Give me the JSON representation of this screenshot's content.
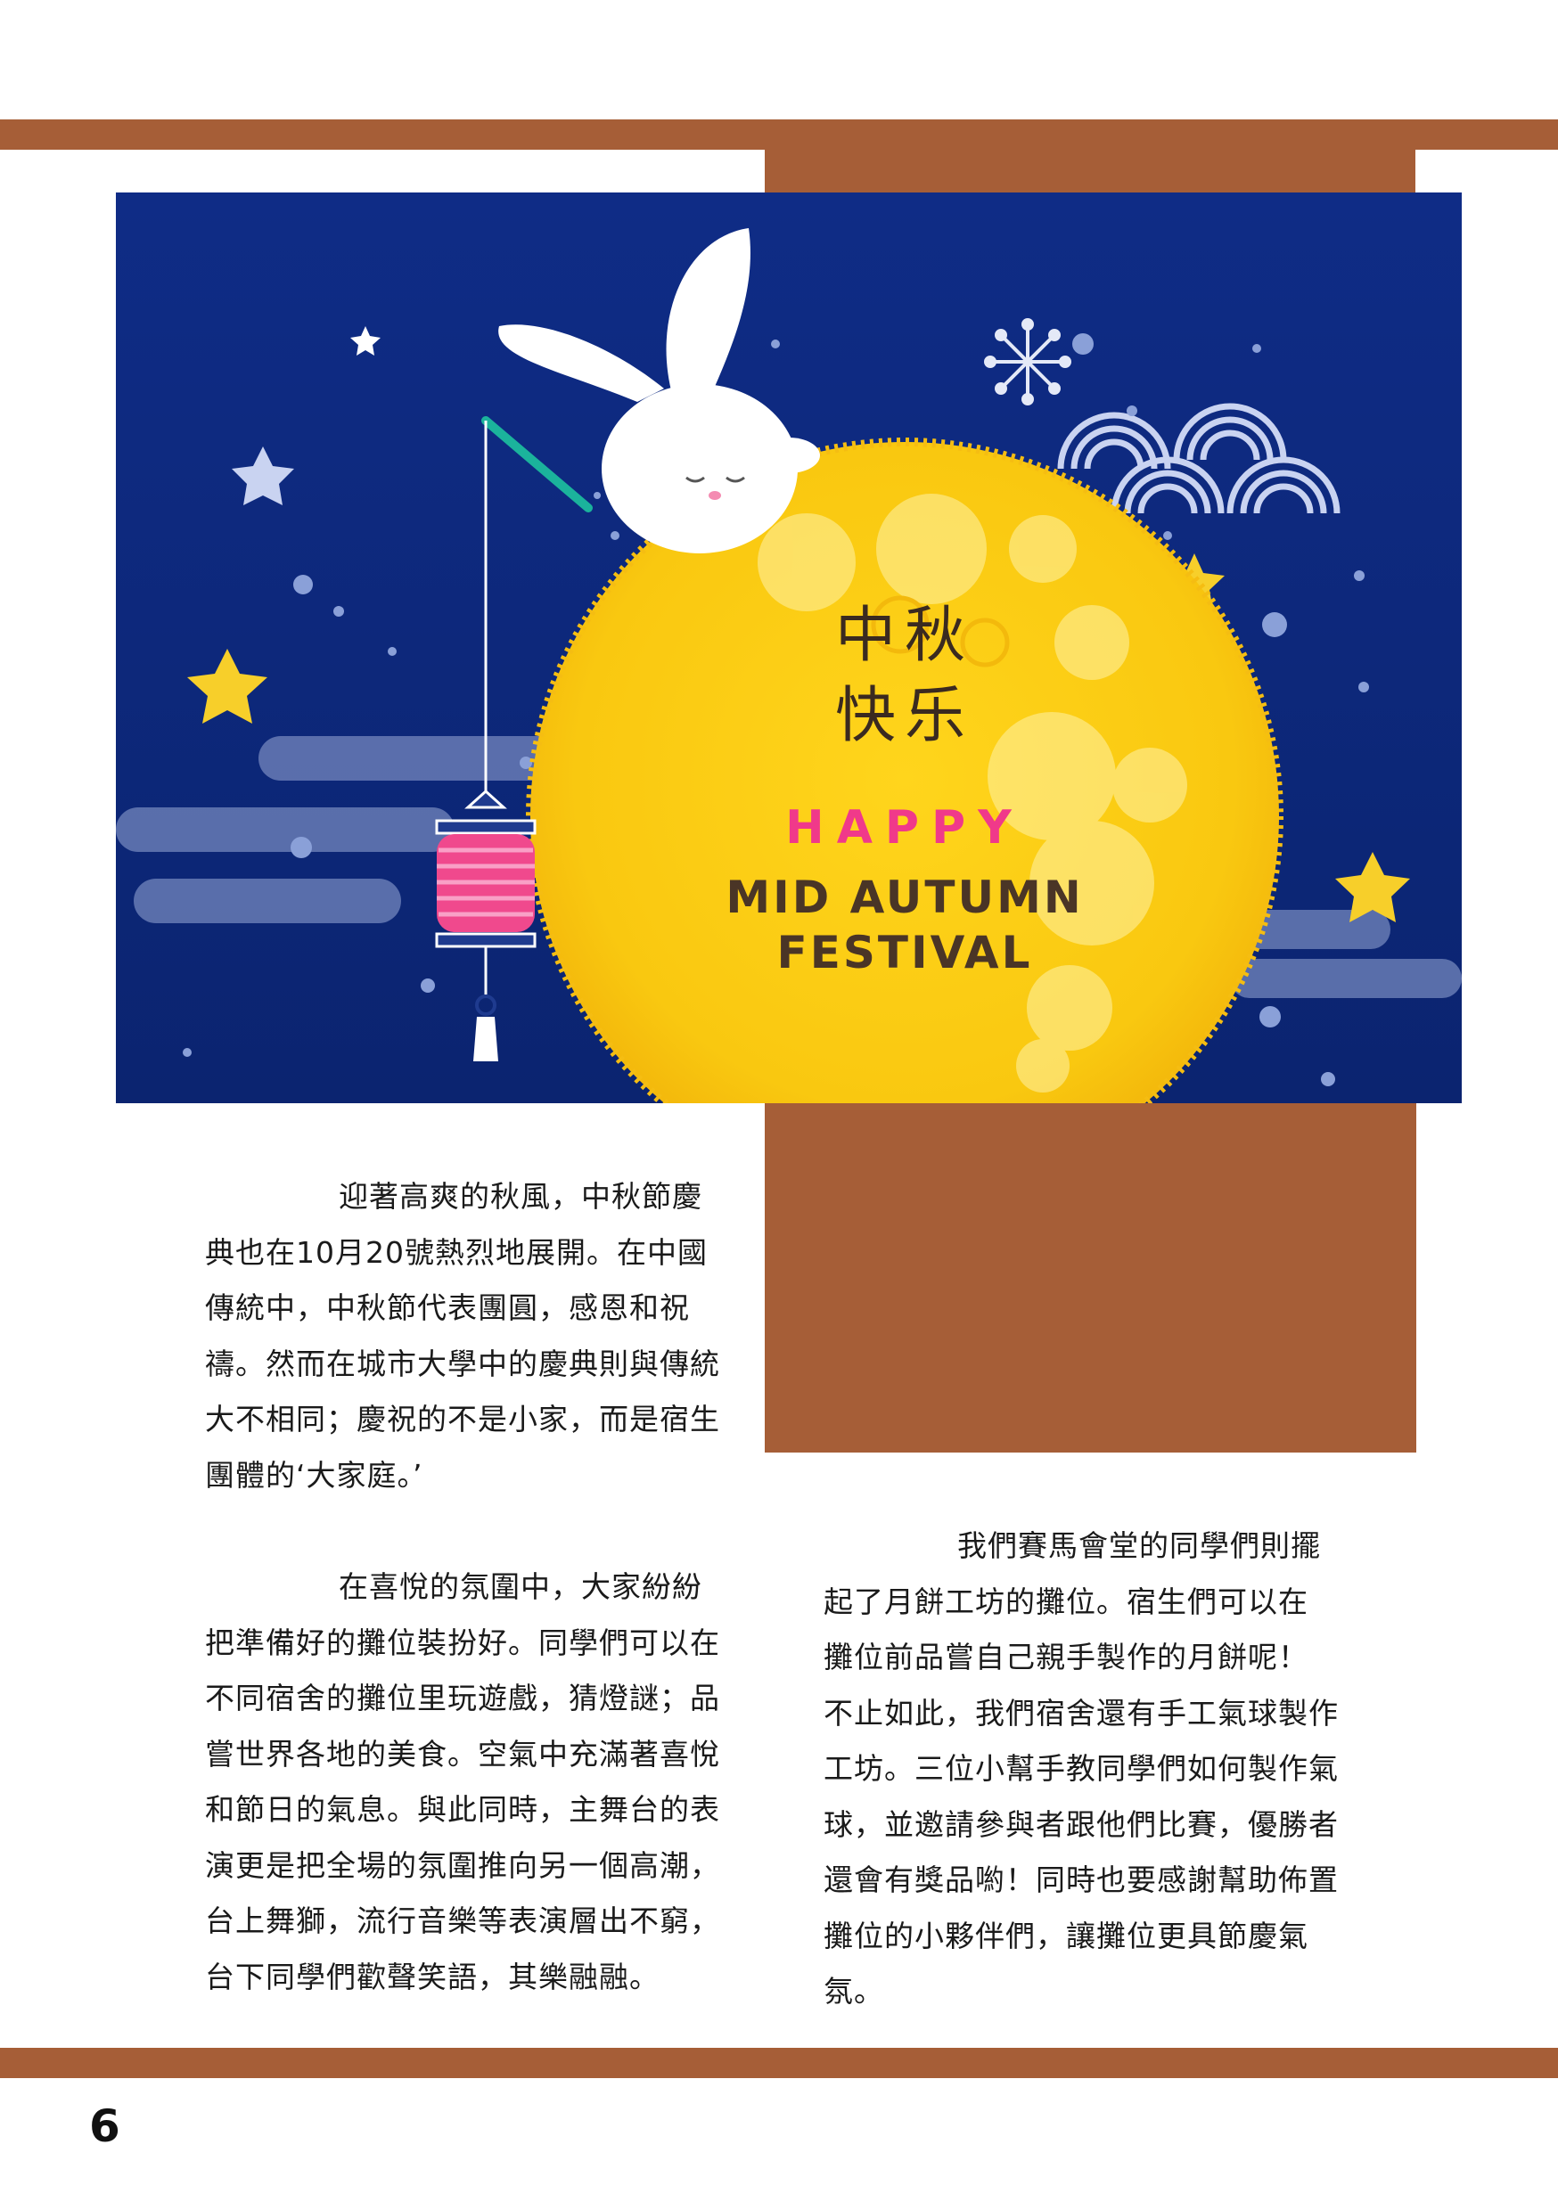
{
  "banner": {
    "chinese_line_1": "中秋",
    "chinese_line_2": "快乐",
    "happy": "HAPPY",
    "title_line_1": "MID AUTUMN",
    "title_line_2": "FESTIVAL"
  },
  "colors": {
    "accent_band": "#a65e37",
    "sky": "#0d2a80",
    "moon": "#f9cb10",
    "happy_text": "#f0398a",
    "title_text": "#4a3526"
  },
  "article": {
    "para1": [
      "迎著高爽的秋風，中秋節慶",
      "典也在10月20號熱烈地展開。在中國",
      "傳統中，中秋節代表團圓，感恩和祝",
      "禱。然而在城市大學中的慶典則與傳統",
      "大不相同；慶祝的不是小家，而是宿生",
      "團體的‘大家庭。’"
    ],
    "para2": [
      "在喜悅的氛圍中，大家紛紛",
      "把準備好的攤位裝扮好。同學們可以在",
      "不同宿舍的攤位里玩遊戲，猜燈謎；品",
      "嘗世界各地的美食。空氣中充滿著喜悅",
      "和節日的氣息。與此同時，主舞台的表",
      "演更是把全場的氛圍推向另一個高潮，",
      "台上舞獅，流行音樂等表演層出不窮，",
      "台下同學們歡聲笑語，其樂融融。"
    ],
    "para3": [
      "我們賽馬會堂的同學們則擺",
      "起了月餅工坊的攤位。宿生們可以在",
      "攤位前品嘗自己親手製作的月餅呢！",
      "不止如此，我們宿舍還有手工氣球製作",
      "工坊。三位小幫手教同學們如何製作氣",
      "球，並邀請參與者跟他們比賽，優勝者",
      "還會有獎品喲！同時也要感謝幫助佈置",
      "攤位的小夥伴們，讓攤位更具節慶氣",
      "氛。"
    ]
  },
  "page_number": "6"
}
